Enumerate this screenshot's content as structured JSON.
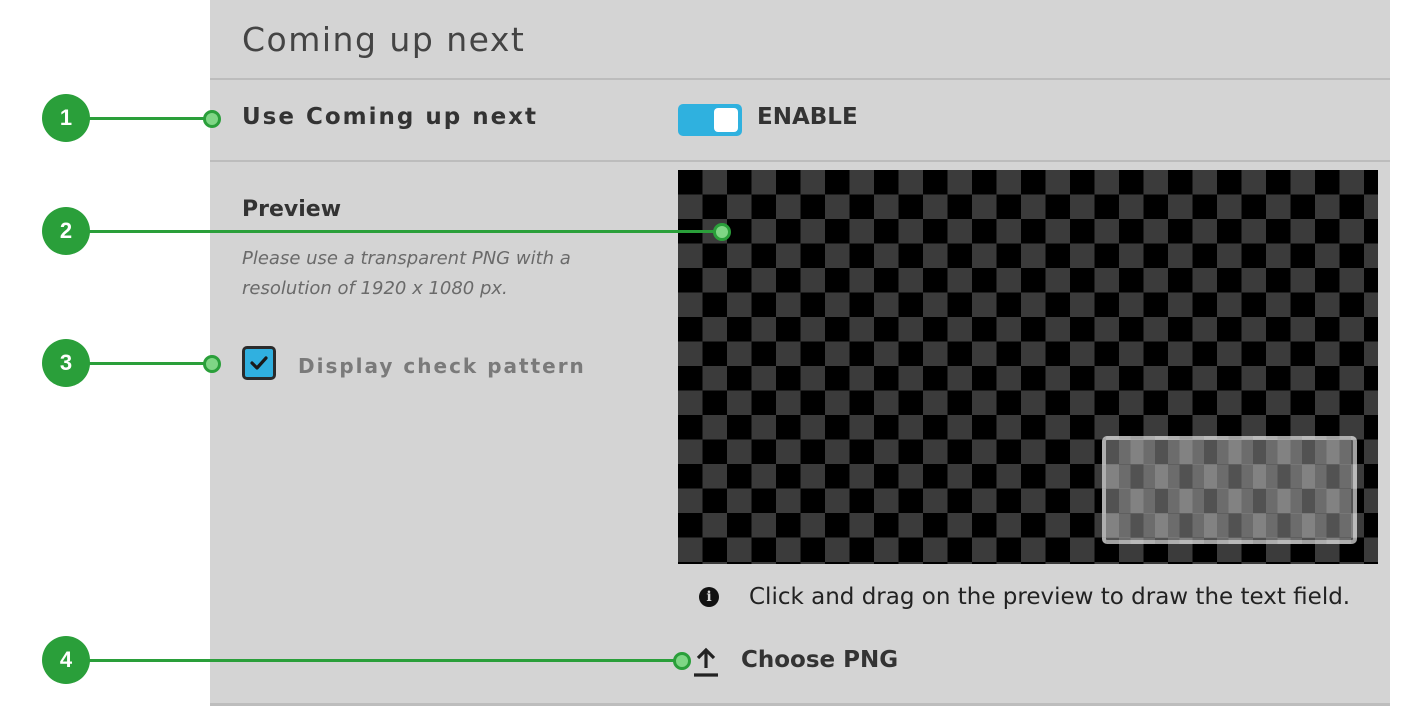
{
  "panel": {
    "title": "Coming up next"
  },
  "setting": {
    "label": "Use Coming up next",
    "toggle_label": "ENABLE",
    "enabled": true
  },
  "preview_section": {
    "label": "Preview",
    "hint": "Please use a transparent PNG with a resolution of 1920 x 1080 px.",
    "checkbox_label": "Display check pattern",
    "checkbox_checked": true,
    "info_text": "Click and drag on the preview to draw the text field.",
    "choose_label": "Choose PNG"
  },
  "callouts": [
    "1",
    "2",
    "3",
    "4"
  ],
  "colors": {
    "accent": "#2fb1df",
    "callout": "#2a9f3a",
    "panel_bg": "#d4d4d4"
  },
  "icons": {
    "info": "info-icon",
    "upload": "upload-icon",
    "check": "check-icon"
  }
}
